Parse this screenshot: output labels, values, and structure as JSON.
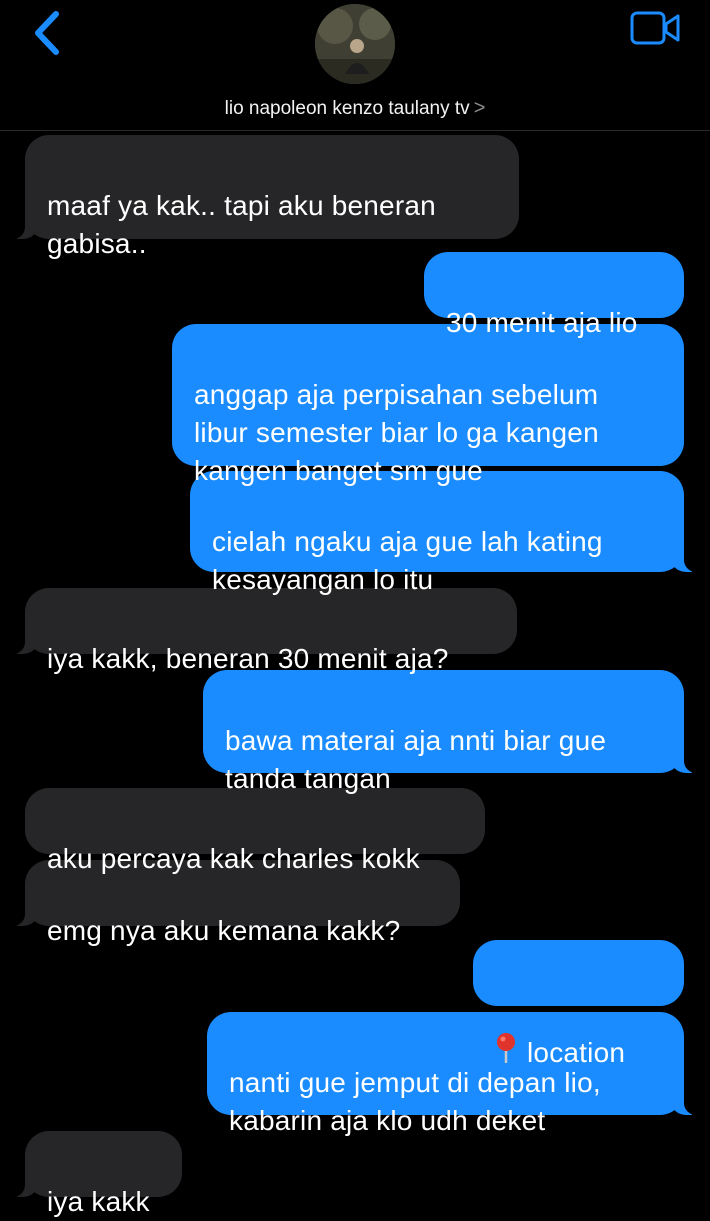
{
  "header": {
    "back_icon": "chevron-left-icon",
    "video_icon": "video-camera-icon",
    "contact_name": "lio napoleon kenzo taulany tv",
    "chevron": ">",
    "accent_color": "#1a8cff"
  },
  "messages": [
    {
      "direction": "incoming",
      "text": "maaf ya kak.. tapi aku beneran\ngabisa.."
    },
    {
      "direction": "outgoing",
      "text": "30 menit aja lio"
    },
    {
      "direction": "outgoing",
      "text": "anggap aja perpisahan sebelum\nlibur semester biar lo ga kangen\nkangen banget sm gue"
    },
    {
      "direction": "outgoing",
      "text": "cielah ngaku aja gue lah kating\nkesayangan lo itu"
    },
    {
      "direction": "incoming",
      "text": "iya kakk, beneran 30 menit aja?"
    },
    {
      "direction": "outgoing",
      "text": "bawa materai aja nnti biar gue\ntanda tangan"
    },
    {
      "direction": "incoming",
      "text": "aku percaya kak charles kokk"
    },
    {
      "direction": "incoming",
      "text": "emg nya aku kemana kakk?"
    },
    {
      "direction": "outgoing",
      "icon": "map-pin-icon",
      "text": "location"
    },
    {
      "direction": "outgoing",
      "text": "nanti gue jemput di depan lio,\nkabarin aja klo udh deket"
    },
    {
      "direction": "incoming",
      "text": "iya kakk"
    }
  ],
  "colors": {
    "incoming_bubble": "#262628",
    "outgoing_bubble": "#1a8cff",
    "background": "#000000"
  }
}
